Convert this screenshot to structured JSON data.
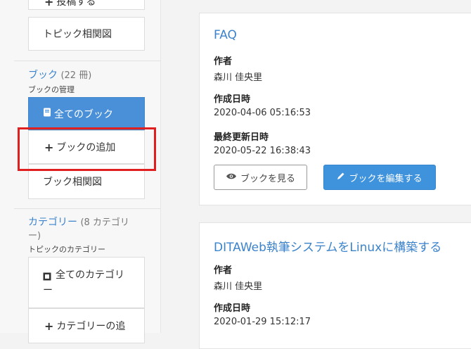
{
  "sidebar": {
    "topics": {
      "post_label": "投稿する",
      "relation_label": "トピック相関図"
    },
    "books": {
      "title": "ブック",
      "count": "(22 冊)",
      "subtitle": "ブックの管理",
      "items": [
        {
          "label": "全てのブック",
          "icon": "book-icon"
        },
        {
          "label": "ブックの追加",
          "icon": "plus-icon"
        },
        {
          "label": "ブック相関図"
        }
      ]
    },
    "categories": {
      "title": "カテゴリー",
      "count": "(8 カテゴリ",
      "title_line2": "ー)",
      "subtitle": "トピックのカテゴリー",
      "items": [
        {
          "label_line1": "全てのカテゴリ",
          "label_line2": "ー",
          "icon": "category-icon"
        },
        {
          "label": "カテゴリーの追",
          "icon": "plus-icon"
        }
      ]
    }
  },
  "cards": [
    {
      "title": "FAQ",
      "author_label": "作者",
      "author": "森川 佳央里",
      "created_label": "作成日時",
      "created": "2020-04-06 05:16:53",
      "updated_label": "最終更新日時",
      "updated": "2020-05-22 16:38:43",
      "view_button": "ブックを見る",
      "edit_button": "ブックを編集する"
    },
    {
      "title": "DITAWeb執筆システムをLinuxに構築する",
      "author_label": "作者",
      "author": "森川 佳央里",
      "created_label": "作成日時",
      "created": "2020-01-29 15:12:17"
    }
  ],
  "colors": {
    "accent": "#3c83cc",
    "active_bg": "#4a90d9",
    "primary_button": "#3f92dc",
    "highlight_box": "#e02020"
  }
}
